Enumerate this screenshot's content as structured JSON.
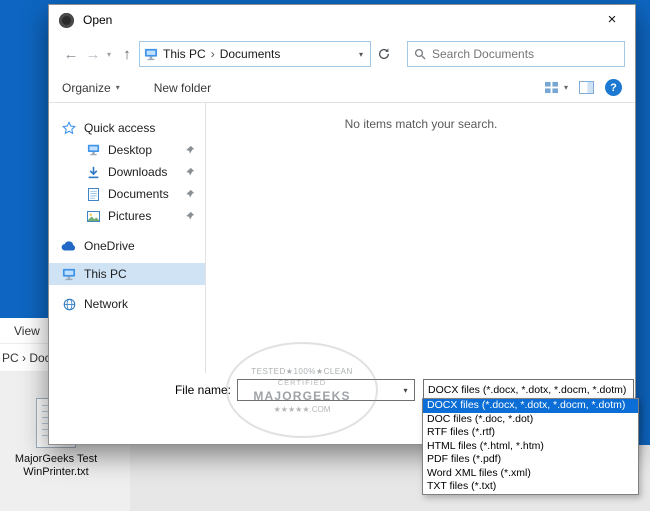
{
  "window": {
    "title": "Open",
    "close_glyph": "×"
  },
  "nav": {
    "back_glyph": "←",
    "forward_glyph": "→",
    "history_dropdown_glyph": "▾",
    "up_glyph": "↑",
    "breadcrumb": {
      "segments": [
        "This PC",
        "Documents"
      ],
      "separator": "›",
      "dropdown_glyph": "▾"
    },
    "search_placeholder": "Search Documents"
  },
  "toolbar": {
    "organize_label": "Organize",
    "organize_dropdown_glyph": "▾",
    "new_folder_label": "New folder",
    "views_dropdown_glyph": "▾",
    "help_glyph": "?"
  },
  "sidebar": {
    "items": [
      {
        "label": "Quick access"
      },
      {
        "label": "Desktop"
      },
      {
        "label": "Downloads"
      },
      {
        "label": "Documents"
      },
      {
        "label": "Pictures"
      },
      {
        "label": "OneDrive"
      },
      {
        "label": "This PC"
      },
      {
        "label": "Network"
      }
    ]
  },
  "main": {
    "empty_message": "No items match your search."
  },
  "footer": {
    "file_name_label": "File name:",
    "file_name_value": "",
    "file_type_value": "DOCX files (*.docx, *.dotx, *.docm, *.dotm)",
    "combo_arrow_glyph": "▾"
  },
  "file_type_dropdown": {
    "options": [
      "DOCX files (*.docx, *.dotx, *.docm, *.dotm)",
      "DOC files (*.doc, *.dot)",
      "RTF files (*.rtf)",
      "HTML files (*.html, *.htm)",
      "PDF files (*.pdf)",
      "Word XML files (*.xml)",
      "TXT files (*.txt)"
    ],
    "selected_index": 0
  },
  "background": {
    "view_label": "View",
    "crumb_text": "PC  ›  Doc",
    "desktop_icon_label": "MajorGeeks Test WinPrinter.txt"
  },
  "watermark": {
    "line1": "TESTED★100%★CLEAN",
    "line2": "CERTIFIED",
    "line3": "MAJORGEEKS",
    "line4": "★★★★★.COM"
  }
}
